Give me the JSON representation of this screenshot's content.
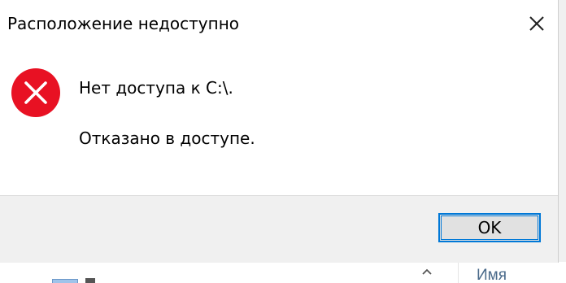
{
  "dialog": {
    "title": "Расположение недоступно",
    "message_line1": "Нет доступа к C:\\.",
    "message_line2": "Отказано в доступе.",
    "ok_label": "OK",
    "icon": "error-icon",
    "close_icon": "close-icon"
  },
  "background": {
    "column_header": "Имя"
  },
  "colors": {
    "error_red": "#e81123",
    "focus_blue": "#0078d7",
    "footer_gray": "#f0f0f0"
  }
}
